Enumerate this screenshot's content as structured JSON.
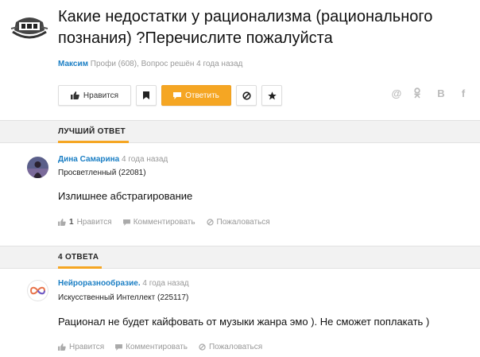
{
  "question": {
    "title": "Какие недостатки у рационализма (рационального познания) ?Перечислите пожалуйста",
    "author": "Максим",
    "meta": " Профи (608), Вопрос решён 4 года назад"
  },
  "toolbar": {
    "like_label": "Нравится",
    "answer_label": "Ответить",
    "answer_color": "#f5a623"
  },
  "share": {
    "mail": "@",
    "ok": "ok",
    "vk": "B",
    "fb": "f"
  },
  "best_section": {
    "label": "ЛУЧШИЙ ОТВЕТ"
  },
  "answers_section": {
    "label": "4 ОТВЕТА"
  },
  "best_answer": {
    "name": "Дина Самарина",
    "time": " 4 года назад",
    "rank": "Просветленный (22081)",
    "text": "Излишнее абстрагирование",
    "like_count": "1",
    "like_label": "Нравится",
    "comment_label": "Комментировать",
    "report_label": "Пожаловаться"
  },
  "answer2": {
    "name": "Нейроразнообразие.",
    "time": " 4 года назад",
    "rank": "Искусственный Интеллект (225117)",
    "text": "Рационал не будет кайфовать от музыки жанра эмо ). Не сможет поплакать )",
    "like_label": "Нравится",
    "comment_label": "Комментировать",
    "report_label": "Пожаловаться"
  },
  "colors": {
    "link": "#1a7ec4",
    "accent": "#f5a623",
    "muted": "#999999"
  }
}
